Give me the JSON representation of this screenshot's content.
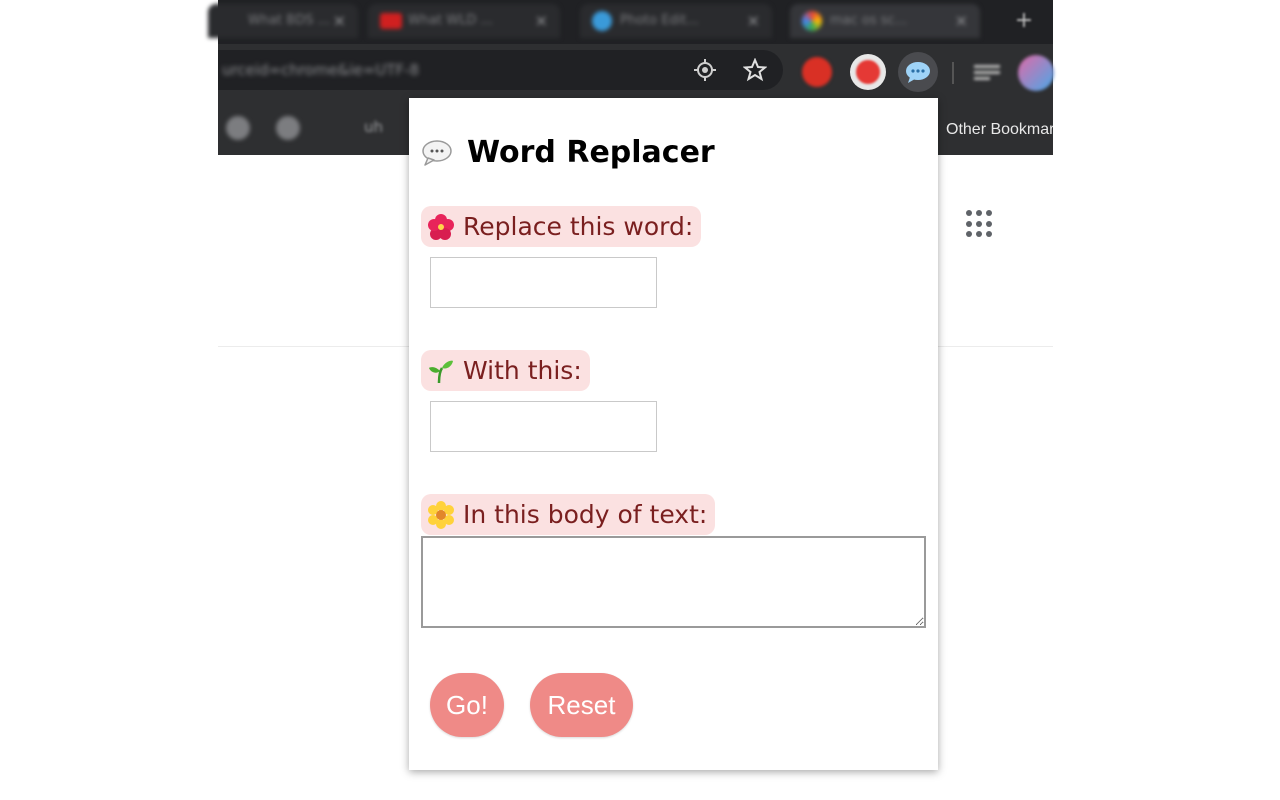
{
  "browser": {
    "tabs": [
      {
        "title": "What BDS ..."
      },
      {
        "title": "What WLD ..."
      },
      {
        "title": "Photo Edit..."
      },
      {
        "title": "mac os sc..."
      }
    ],
    "new_tab_symbol": "+",
    "close_symbol": "×",
    "url": "urceid=chrome&ie=UTF-8",
    "bookmarks": {
      "item_uh": "uh",
      "other_bookmarks": "Other Bookmarks"
    }
  },
  "popup": {
    "title": "Word Replacer",
    "replace_label": "Replace this word:",
    "replace_value": "",
    "with_label": "With this:",
    "with_value": "",
    "body_label": "In this body of text:",
    "body_value": "",
    "go_button": "Go!",
    "reset_button": "Reset"
  },
  "colors": {
    "label_bg": "#fbe1e1",
    "label_text": "#7a1f1f",
    "button_bg": "#ef8a87",
    "chrome_bg": "#2e2f31"
  },
  "icons": {
    "title_icon": "speech-bubble-icon",
    "replace_icon": "hibiscus-icon",
    "with_icon": "seedling-icon",
    "body_icon": "sunflower-icon"
  }
}
